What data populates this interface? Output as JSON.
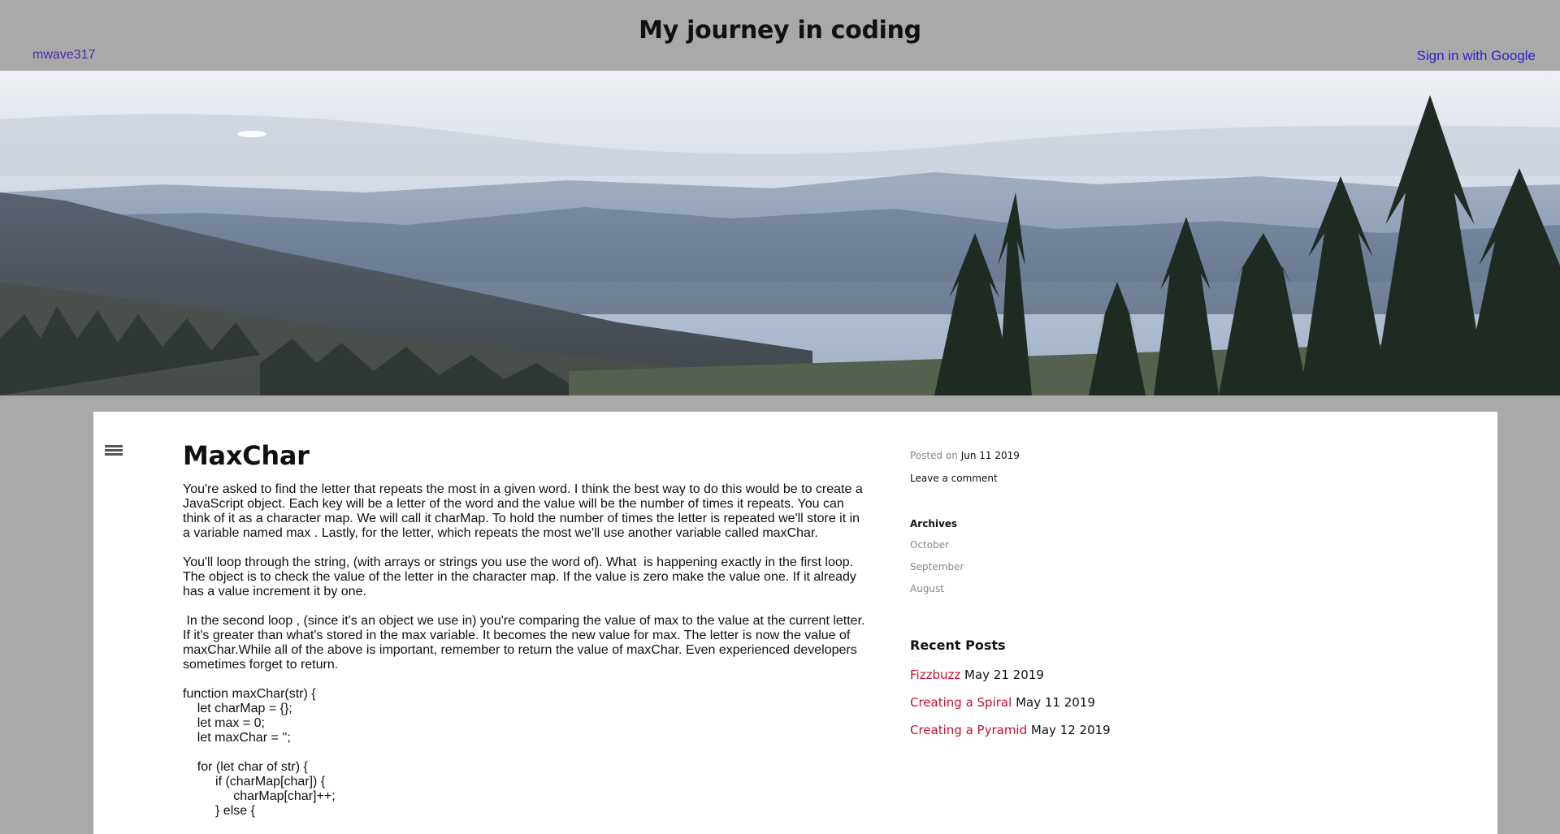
{
  "header": {
    "title": "My journey in coding",
    "user": "mwave317",
    "signin": "Sign in with Google"
  },
  "post": {
    "title": "MaxChar",
    "paragraphs": [
      "You're asked to find the letter that repeats the most in a given word. I think the best way to do this would be to create a JavaScript object. Each key will be a letter of the word and the value will be the number of times it repeats. You can think of it as a character map. We will call it charMap. To hold the number of times the letter is repeated we'll store it in a variable named max . Lastly, for the letter, which repeats the most we'll use another variable called maxChar.",
      "You'll loop through the string, (with arrays or strings you use the word of). What  is happening exactly in the first loop. The object is to check the value of the letter in the character map. If the value is zero make the value one. If it already has a value increment it by one.",
      " In the second loop , (since it's an object we use in) you're comparing the value of max to the value at the current letter. If it's greater than what's stored in the max variable. It becomes the new value for max. The letter is now the value of maxChar.While all of the above is important, remember to return the value of maxChar. Even experienced developers sometimes forget to return."
    ],
    "code": "function maxChar(str) {\n    let charMap = {};\n    let max = 0;\n    let maxChar = '';\n\n    for (let char of str) {\n         if (charMap[char]) {\n              charMap[char]++;\n         } else {"
  },
  "sidebar": {
    "posted_on_label": "Posted on",
    "posted_date": "Jun 11 2019",
    "leave_comment": "Leave a comment",
    "archives_title": "Archives",
    "archives": [
      "October",
      "September",
      "August"
    ],
    "recent_title": "Recent Posts",
    "recent_posts": [
      {
        "title": "Fizzbuzz",
        "date": "May 21 2019"
      },
      {
        "title": "Creating a Spiral",
        "date": "May 11 2019"
      },
      {
        "title": "Creating a Pyramid",
        "date": "May 12 2019"
      }
    ]
  },
  "icons": {
    "menu": "hamburger-menu-icon"
  },
  "colors": {
    "background": "#aaa9aa",
    "link_accent": "#c8102e",
    "signin_link": "#2d22d0",
    "user_link": "#4b2aa8"
  }
}
